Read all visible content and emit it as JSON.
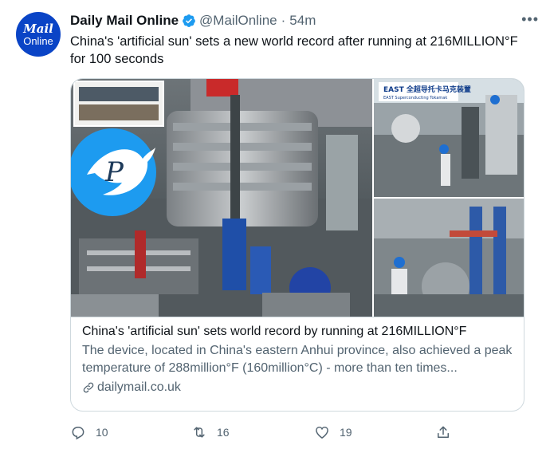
{
  "account": {
    "avatar_line1": "Mail",
    "avatar_line2": "Online",
    "name": "Daily Mail Online",
    "handle": "@MailOnline",
    "separator": "·",
    "time": "54m"
  },
  "tweet": {
    "text": "China's 'artificial sun' sets a new world record after running at 216MILLION°F for 100 seconds"
  },
  "card": {
    "title": "China's 'artificial sun' sets world record by running at 216MILLION°F",
    "description": "The device, located in China's eastern Anhui province, also achieved a peak temperature of 288million°F (160million°C) - more than ten times...",
    "domain": "dailymail.co.uk",
    "sign_text": "EAST 全超导托卡马克装置",
    "sign_subtext": "EAST Superconducting Tokamak"
  },
  "actions": {
    "replies": "10",
    "retweets": "16",
    "likes": "19"
  },
  "colors": {
    "avatar_bg": "#0a44c6",
    "verified": "#1d9bf0",
    "muted": "#536471",
    "border": "#cfd9de"
  }
}
